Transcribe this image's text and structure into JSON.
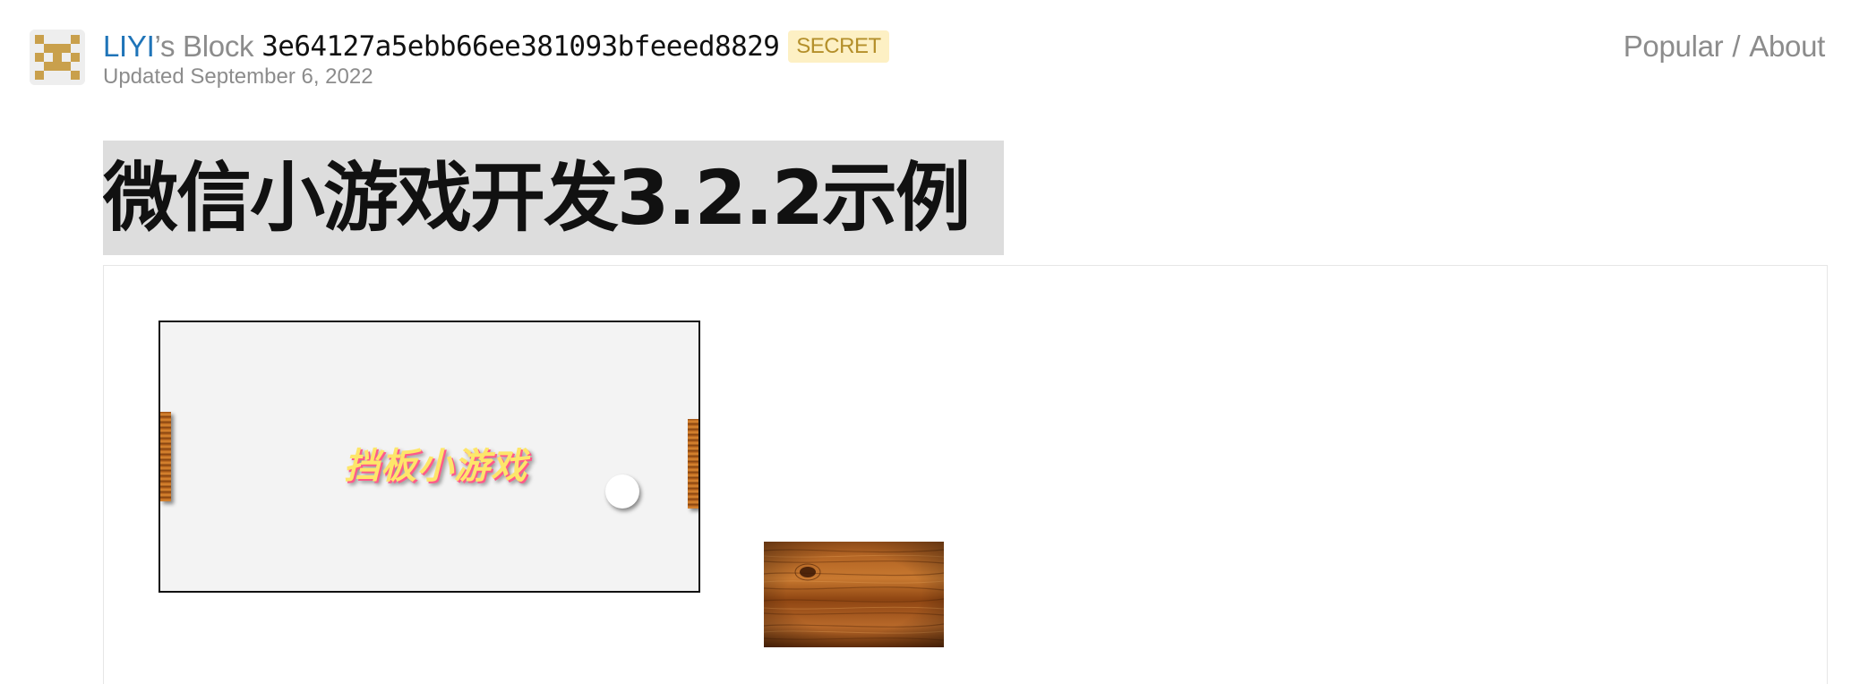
{
  "header": {
    "owner": "LIYI",
    "owner_suffix": "’s Block",
    "gist_id": "3e64127a5ebb66ee381093bfeeed8829",
    "badge": "SECRET",
    "updated": "Updated September 6, 2022"
  },
  "nav": {
    "popular": "Popular",
    "separator": "/",
    "about": "About"
  },
  "page": {
    "title": "微信小游戏开发3.2.2示例"
  },
  "game": {
    "title": "挡板小游戏",
    "icons": [
      "paddle-left",
      "paddle-right",
      "ball"
    ]
  },
  "colors": {
    "link": "#1f74b8",
    "muted": "#8c8c8c",
    "badge_bg": "#fdf0c4",
    "badge_text": "#b48f2a",
    "heading_bg": "#dddddd",
    "canvas_bg": "#f3f3f3",
    "avatar": "#c9a04c"
  }
}
